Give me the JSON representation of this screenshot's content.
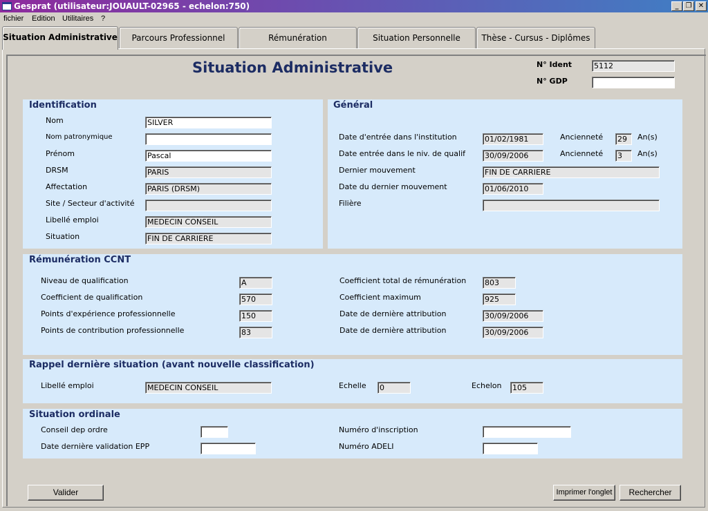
{
  "window": {
    "title": "Gesprat (utilisateur:JOUAULT-02965 - echelon:750)",
    "controls": {
      "minimize": "_",
      "restore": "❐",
      "close": "✕"
    }
  },
  "menu": [
    "fichier",
    "Edition",
    "Utilitaires",
    "?"
  ],
  "tabs": [
    "Situation Administrative",
    "Parcours Professionnel",
    "Rémunération",
    "Situation Personnelle",
    "Thèse - Cursus - Diplômes"
  ],
  "page_title": "Situation Administrative",
  "header": {
    "ident_label": "N° Ident",
    "ident_value": "5112",
    "gdp_label": "N° GDP",
    "gdp_value": ""
  },
  "identification": {
    "title": "Identification",
    "fields": [
      {
        "label": "Nom",
        "value": "SILVER"
      },
      {
        "label": "Nom patronymique",
        "value": ""
      },
      {
        "label": "Prénom",
        "value": "Pascal"
      },
      {
        "label": "DRSM",
        "value": "PARIS"
      },
      {
        "label": "Affectation",
        "value": "PARIS (DRSM)"
      },
      {
        "label": "Site / Secteur d'activité",
        "value": ""
      },
      {
        "label": "Libellé emploi",
        "value": "MEDECIN CONSEIL"
      },
      {
        "label": "Situation",
        "value": "FIN DE CARRIERE"
      }
    ]
  },
  "general": {
    "title": "Général",
    "date_entree_inst_label": "Date d'entrée dans l'institution",
    "date_entree_inst_value": "01/02/1981",
    "anciennete1_label": "Ancienneté",
    "anciennete1_value": "29",
    "anciennete1_unit": "An(s)",
    "date_entree_qualif_label": "Date entrée dans le niv. de qualif",
    "date_entree_qualif_value": "30/09/2006",
    "anciennete2_label": "Ancienneté",
    "anciennete2_value": "3",
    "anciennete2_unit": "An(s)",
    "dernier_mvt_label": "Dernier mouvement",
    "dernier_mvt_value": "FIN DE CARRIERE",
    "date_dernier_mvt_label": "Date du dernier mouvement",
    "date_dernier_mvt_value": "01/06/2010",
    "filiere_label": "Filière",
    "filiere_value": ""
  },
  "remuneration": {
    "title": "Rémunération CCNT",
    "niveau_label": "Niveau de qualification",
    "niveau_value": "A",
    "coef_qualif_label": "Coefficient de qualification",
    "coef_qualif_value": "570",
    "points_exp_label": "Points d'expérience professionnelle",
    "points_exp_value": "150",
    "points_contrib_label": "Points de contribution professionnelle",
    "points_contrib_value": "83",
    "coef_total_label": "Coefficient total de rémunération",
    "coef_total_value": "803",
    "coef_max_label": "Coefficient maximum",
    "coef_max_value": "925",
    "date_attr1_label": "Date de dernière attribution",
    "date_attr1_value": "30/09/2006",
    "date_attr2_label": "Date de dernière attribution",
    "date_attr2_value": "30/09/2006"
  },
  "rappel": {
    "title": "Rappel dernière situation (avant nouvelle classification)",
    "libelle_label": "Libellé emploi",
    "libelle_value": "MEDECIN CONSEIL",
    "echelle_label": "Echelle",
    "echelle_value": "0",
    "echelon_label": "Echelon",
    "echelon_value": "105"
  },
  "ordinale": {
    "title": "Situation ordinale",
    "conseil_label": "Conseil dep ordre",
    "conseil_value": "",
    "date_epp_label": "Date dernière validation EPP",
    "date_epp_value": "",
    "num_inscr_label": "Numéro d'inscription",
    "num_inscr_value": "",
    "num_adeli_label": "Numéro ADELI",
    "num_adeli_value": ""
  },
  "buttons": {
    "valider": "Valider",
    "imprimer": "Imprimer l'onglet",
    "rechercher": "Rechercher"
  }
}
